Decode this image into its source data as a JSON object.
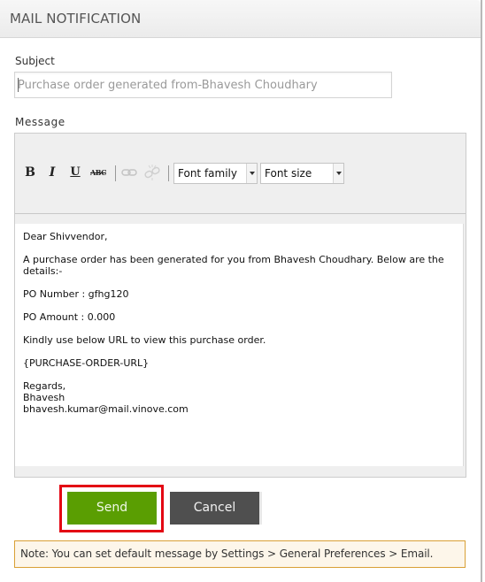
{
  "dialog": {
    "title": "MAIL NOTIFICATION"
  },
  "subject": {
    "label": "Subject",
    "placeholder": "Purchase order generated from-Bhavesh Choudhary",
    "value": ""
  },
  "message": {
    "label": "Message",
    "toolbar": {
      "bold": "B",
      "italic": "I",
      "underline": "U",
      "strikethrough": "ABC",
      "font_family": "Font family",
      "font_size": "Font size"
    },
    "body": {
      "greeting": "Dear Shivvendor,",
      "intro": "A purchase order has been generated for you from Bhavesh Choudhary. Below are the details:-",
      "po_number": "PO Number : gfhg120",
      "po_amount": "PO Amount : 0.000",
      "url_instruction": "Kindly use below URL to view this purchase order.",
      "url_placeholder": "{PURCHASE-ORDER-URL}",
      "closing": "Regards,",
      "sender_name": "Bhavesh",
      "sender_email": "bhavesh.kumar@mail.vinove.com"
    }
  },
  "actions": {
    "send_label": "Send",
    "cancel_label": "Cancel"
  },
  "note": {
    "text": "Note: You can set default message by Settings > General Preferences > Email."
  },
  "colors": {
    "send": "#5a9e02",
    "cancel": "#4f4f4f",
    "highlight": "#e30613",
    "note_border": "#d9a036",
    "note_bg": "#fdf6ea"
  }
}
